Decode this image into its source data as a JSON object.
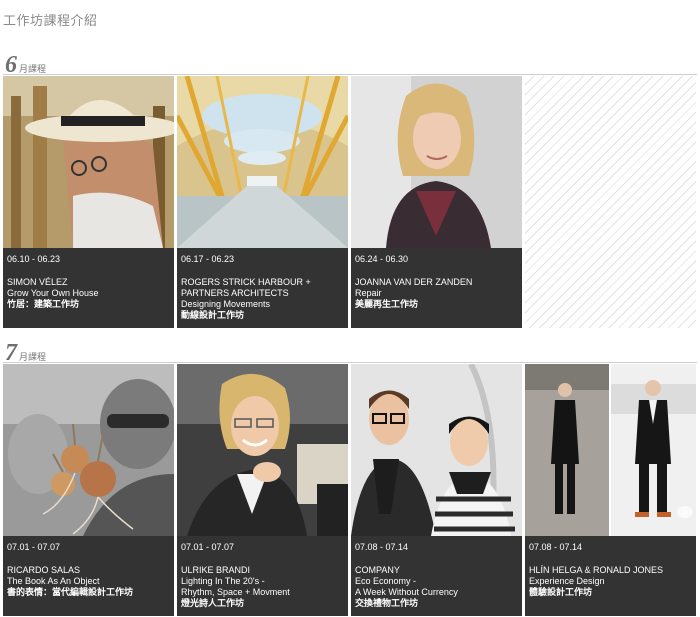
{
  "page_title": "工作坊課程介紹",
  "months": [
    {
      "number": "6",
      "unit": "月課程",
      "courses": [
        {
          "date": "06.10 - 06.23",
          "lines": [
            "SIMON VÉLEZ",
            "Grow Your Own House"
          ],
          "zh": "竹居：建築工作坊",
          "icon": "person-portrait-straw-hat"
        },
        {
          "date": "06.17 - 06.23",
          "lines": [
            "ROGERS STRICK HARBOUR +",
            "PARTNERS ARCHITECTS",
            "Designing Movements"
          ],
          "zh": "動線設計工作坊",
          "icon": "airport-terminal-architecture"
        },
        {
          "date": "06.24 - 06.30",
          "lines": [
            "JOANNA VAN DER ZANDEN",
            "Repair"
          ],
          "zh": "美麗再生工作坊",
          "icon": "person-portrait-woman-blonde"
        }
      ]
    },
    {
      "number": "7",
      "unit": "月課程",
      "courses": [
        {
          "date": "07.01 - 07.07",
          "lines": [
            "RICARDO SALAS",
            "The Book As An Object"
          ],
          "zh": "書的表情：當代編輯設計工作坊",
          "icon": "person-holding-onions"
        },
        {
          "date": "07.01 - 07.07",
          "lines": [
            "ULRIKE BRANDI",
            "Lighting In The 20's -",
            "Rhythm, Space + Movment"
          ],
          "zh": "燈光詩人工作坊",
          "icon": "person-portrait-woman-smiling"
        },
        {
          "date": "07.08 - 07.14",
          "lines": [
            "COMPANY",
            "Eco Economy -",
            "A Week Without Currency"
          ],
          "zh": "交換禮物工作坊",
          "icon": "two-people-portrait"
        },
        {
          "date": "07.08 - 07.14",
          "lines": [
            "HLÍN HELGA & RONALD JONES",
            "Experience Design"
          ],
          "zh": "體驗設計工作坊",
          "icon": "two-people-standing"
        }
      ]
    }
  ]
}
